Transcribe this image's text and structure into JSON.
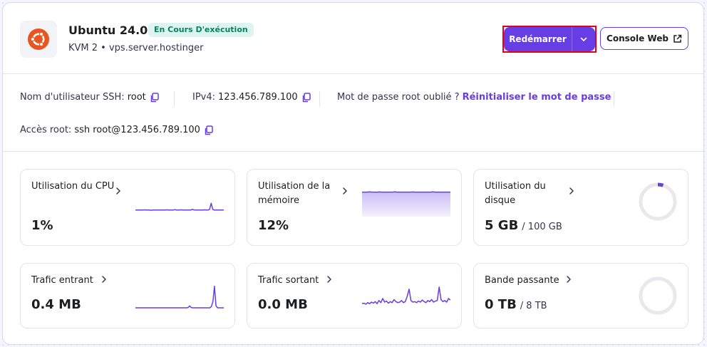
{
  "colors": {
    "accent": "#673de6",
    "status_bg": "#def4f0",
    "status_text": "#00865e",
    "os_orange": "#e95420"
  },
  "vps": {
    "os_icon": "ubuntu-icon",
    "title": "Ubuntu 24.04",
    "status": "En Cours D'exécution",
    "subtitle": "KVM 2 • vps.server.hostinger"
  },
  "actions": {
    "restart_label": "Redémarrer",
    "restart_menu_icon": "chevron-down-icon",
    "console_label": "Console Web",
    "console_icon": "external-link-icon"
  },
  "access": {
    "ssh_user_label": "Nom d'utilisateur SSH:",
    "ssh_user_value": "root",
    "ipv4_label": "IPv4:",
    "ipv4_value": "123.456.789.100",
    "forgot_label": "Mot de passe root oublié ?",
    "reset_link": "Réinitialiser le mot de passe",
    "root_access_label": "Accès root:",
    "root_access_value": "ssh root@123.456.789.100",
    "copy_icon": "copy-icon"
  },
  "metrics": [
    {
      "key": "cpu",
      "label": "Utilisation du CPU",
      "value": "1%",
      "unit": "",
      "chart": "line",
      "series": [
        1,
        1,
        1,
        1,
        1,
        1,
        1.1,
        1,
        1,
        1,
        0.9,
        1,
        1,
        1,
        1,
        1,
        1,
        1,
        1,
        1,
        1.1,
        1,
        1,
        1,
        1,
        1.2,
        1,
        1,
        1,
        1.1,
        1,
        1,
        1,
        1,
        1,
        1,
        1.3,
        1.1,
        1,
        1,
        1,
        1,
        1,
        1,
        1.1,
        1,
        1,
        1.3,
        4,
        1.3,
        1,
        1,
        1,
        1,
        1,
        1,
        1
      ],
      "ymax": 10,
      "fill": false
    },
    {
      "key": "memory",
      "label": "Utilisation de la mémoire",
      "value": "12%",
      "unit": "",
      "chart": "area",
      "series": [
        96,
        96,
        96,
        97,
        96,
        96,
        96,
        96.5,
        96,
        96,
        96,
        96,
        96,
        97,
        96,
        96,
        96,
        96,
        96,
        96,
        96.5,
        96,
        96,
        96,
        96,
        96,
        96,
        96,
        97,
        96,
        96,
        96,
        96,
        96,
        96,
        96
      ],
      "ymax": 100,
      "fill": true
    },
    {
      "key": "disk",
      "label": "Utilisation du disque",
      "value": "5 GB",
      "unit": "/ 100 GB",
      "chart": "ring",
      "fraction": 0.05
    },
    {
      "key": "in",
      "label": "Trafic entrant",
      "value": "0.4 MB",
      "unit": "",
      "chart": "line",
      "series": [
        0,
        0,
        0,
        0,
        0,
        0,
        0,
        0,
        0,
        0,
        0,
        0,
        0,
        0,
        0,
        0,
        0,
        0,
        0,
        0,
        0,
        0,
        0,
        0,
        0,
        0,
        0,
        0,
        0,
        0,
        0,
        0,
        0,
        0,
        0.5,
        3,
        0.5,
        0,
        0,
        0,
        0,
        0,
        0,
        0,
        0,
        0,
        0,
        0,
        0,
        2,
        10,
        34,
        3,
        0,
        0,
        0,
        0,
        0
      ],
      "ymax": 36,
      "fill": false
    },
    {
      "key": "out",
      "label": "Trafic sortant",
      "value": "0.0 MB",
      "unit": "",
      "chart": "line",
      "series": [
        8,
        9,
        7,
        10,
        8,
        11,
        9,
        12,
        8,
        14,
        10,
        18,
        11,
        13,
        9,
        12,
        10,
        16,
        12,
        10,
        11,
        14,
        10,
        12,
        22,
        36,
        14,
        11,
        12,
        10,
        13,
        11,
        15,
        12,
        10,
        14,
        12,
        16,
        11,
        13,
        14,
        40,
        16,
        12,
        14,
        11,
        18,
        15
      ],
      "ymax": 44,
      "fill": false
    },
    {
      "key": "bandwidth",
      "label": "Bande passante",
      "value": "0 TB",
      "unit": "/ 8 TB",
      "chart": "ring",
      "fraction": 0
    }
  ],
  "chevron_icon": "chevron-right-icon"
}
